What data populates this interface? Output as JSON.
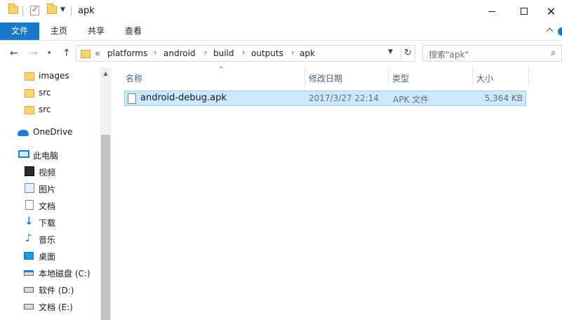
{
  "window": {
    "title": "apk",
    "quick_access": [
      "folder-icon",
      "properties-check-icon",
      "new-folder-icon",
      "dropdown-icon"
    ]
  },
  "ribbon": {
    "tabs": [
      "文件",
      "主页",
      "共享",
      "查看"
    ]
  },
  "address": {
    "overflow": "«",
    "crumbs": [
      "platforms",
      "android",
      "build",
      "outputs",
      "apk"
    ],
    "separator": "›",
    "refresh": "↻"
  },
  "search": {
    "placeholder": "搜索\"apk\"",
    "icon": "⌕"
  },
  "nav": {
    "items": [
      {
        "label": "images",
        "icon": "folder-icon"
      },
      {
        "label": "src",
        "icon": "folder-icon"
      },
      {
        "label": "src",
        "icon": "folder-icon"
      },
      {
        "label": "OneDrive",
        "icon": "onedrive-icon"
      },
      {
        "label": "此电脑",
        "icon": "this-pc-icon"
      },
      {
        "label": "视频",
        "icon": "videos-icon"
      },
      {
        "label": "图片",
        "icon": "pictures-icon"
      },
      {
        "label": "文档",
        "icon": "documents-icon"
      },
      {
        "label": "下载",
        "icon": "downloads-icon"
      },
      {
        "label": "音乐",
        "icon": "music-icon"
      },
      {
        "label": "桌面",
        "icon": "desktop-icon"
      },
      {
        "label": "本地磁盘 (C:)",
        "icon": "system-drive-icon"
      },
      {
        "label": "软件 (D:)",
        "icon": "drive-icon"
      },
      {
        "label": "文档 (E:)",
        "icon": "drive-icon"
      }
    ]
  },
  "columns": {
    "name": "名称",
    "modified": "修改日期",
    "type": "类型",
    "size": "大小"
  },
  "files": [
    {
      "name": "android-debug.apk",
      "modified": "2017/3/27 22:14",
      "type": "APK 文件",
      "size": "5,364 KB",
      "selected": true
    }
  ],
  "colors": {
    "accent": "#1979ca",
    "selection_bg": "#cce8ff",
    "selection_border": "#99d1ff",
    "header_text": "#4c607a"
  }
}
